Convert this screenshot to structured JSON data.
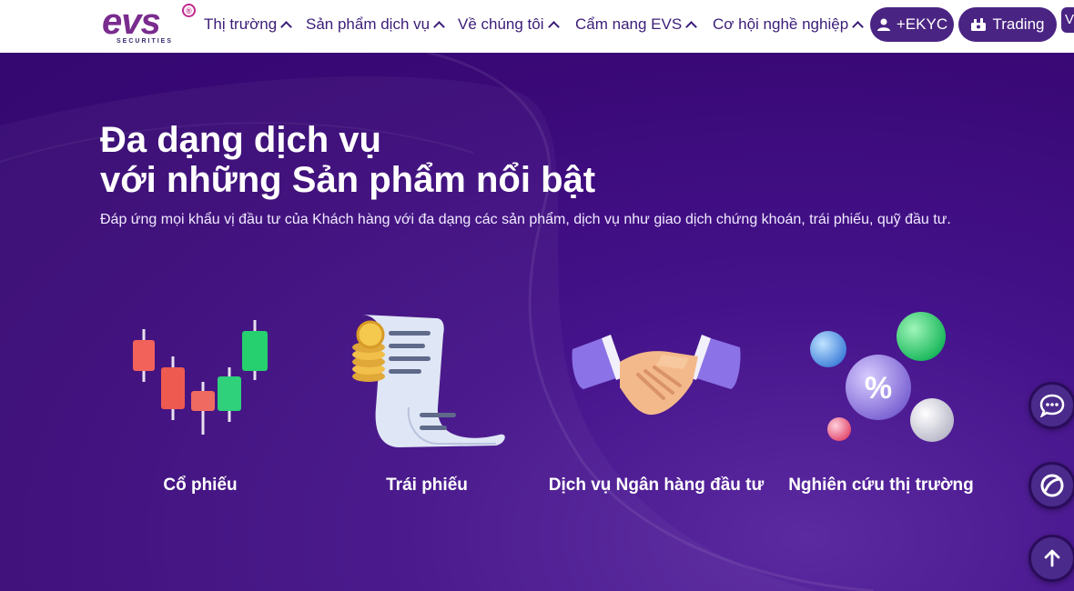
{
  "brand": {
    "logo_text": "evs",
    "logo_sub": "SECURITIES",
    "logo_mark": "®"
  },
  "nav": {
    "items": [
      {
        "label": "Thị trường"
      },
      {
        "label": "Sản phẩm dịch vụ"
      },
      {
        "label": "Về chúng tôi"
      },
      {
        "label": "Cẩm nang EVS"
      },
      {
        "label": "Cơ hội nghề nghiệp"
      }
    ],
    "ekyc_label": "+EKYC",
    "trading_label": "Trading",
    "edge_label": "V"
  },
  "hero": {
    "title_line1": "Đa dạng dịch vụ",
    "title_line2": "với những Sản phẩm nổi bật",
    "subtitle": "Đáp ứng mọi khẩu vị đầu tư của Khách hàng với đa dạng các sản phẩm, dịch vụ như giao dịch chứng khoán, trái phiếu, quỹ đầu tư."
  },
  "products": [
    {
      "label": "Cổ phiếu",
      "icon": "candlestick-chart-icon"
    },
    {
      "label": "Trái phiếu",
      "icon": "bond-document-icon"
    },
    {
      "label": "Dịch vụ Ngân hàng đầu tư",
      "icon": "handshake-icon"
    },
    {
      "label": "Nghiên cứu thị trường",
      "icon": "percent-bubbles-icon"
    }
  ],
  "floating": [
    {
      "icon": "chat-icon"
    },
    {
      "icon": "brand-swirl-icon"
    },
    {
      "icon": "arrow-up-icon"
    }
  ],
  "colors": {
    "nav_text": "#3b1d78",
    "pill": "#4a2483",
    "hero_bg": "#3d0a78",
    "logo": "#7a2c8e"
  }
}
